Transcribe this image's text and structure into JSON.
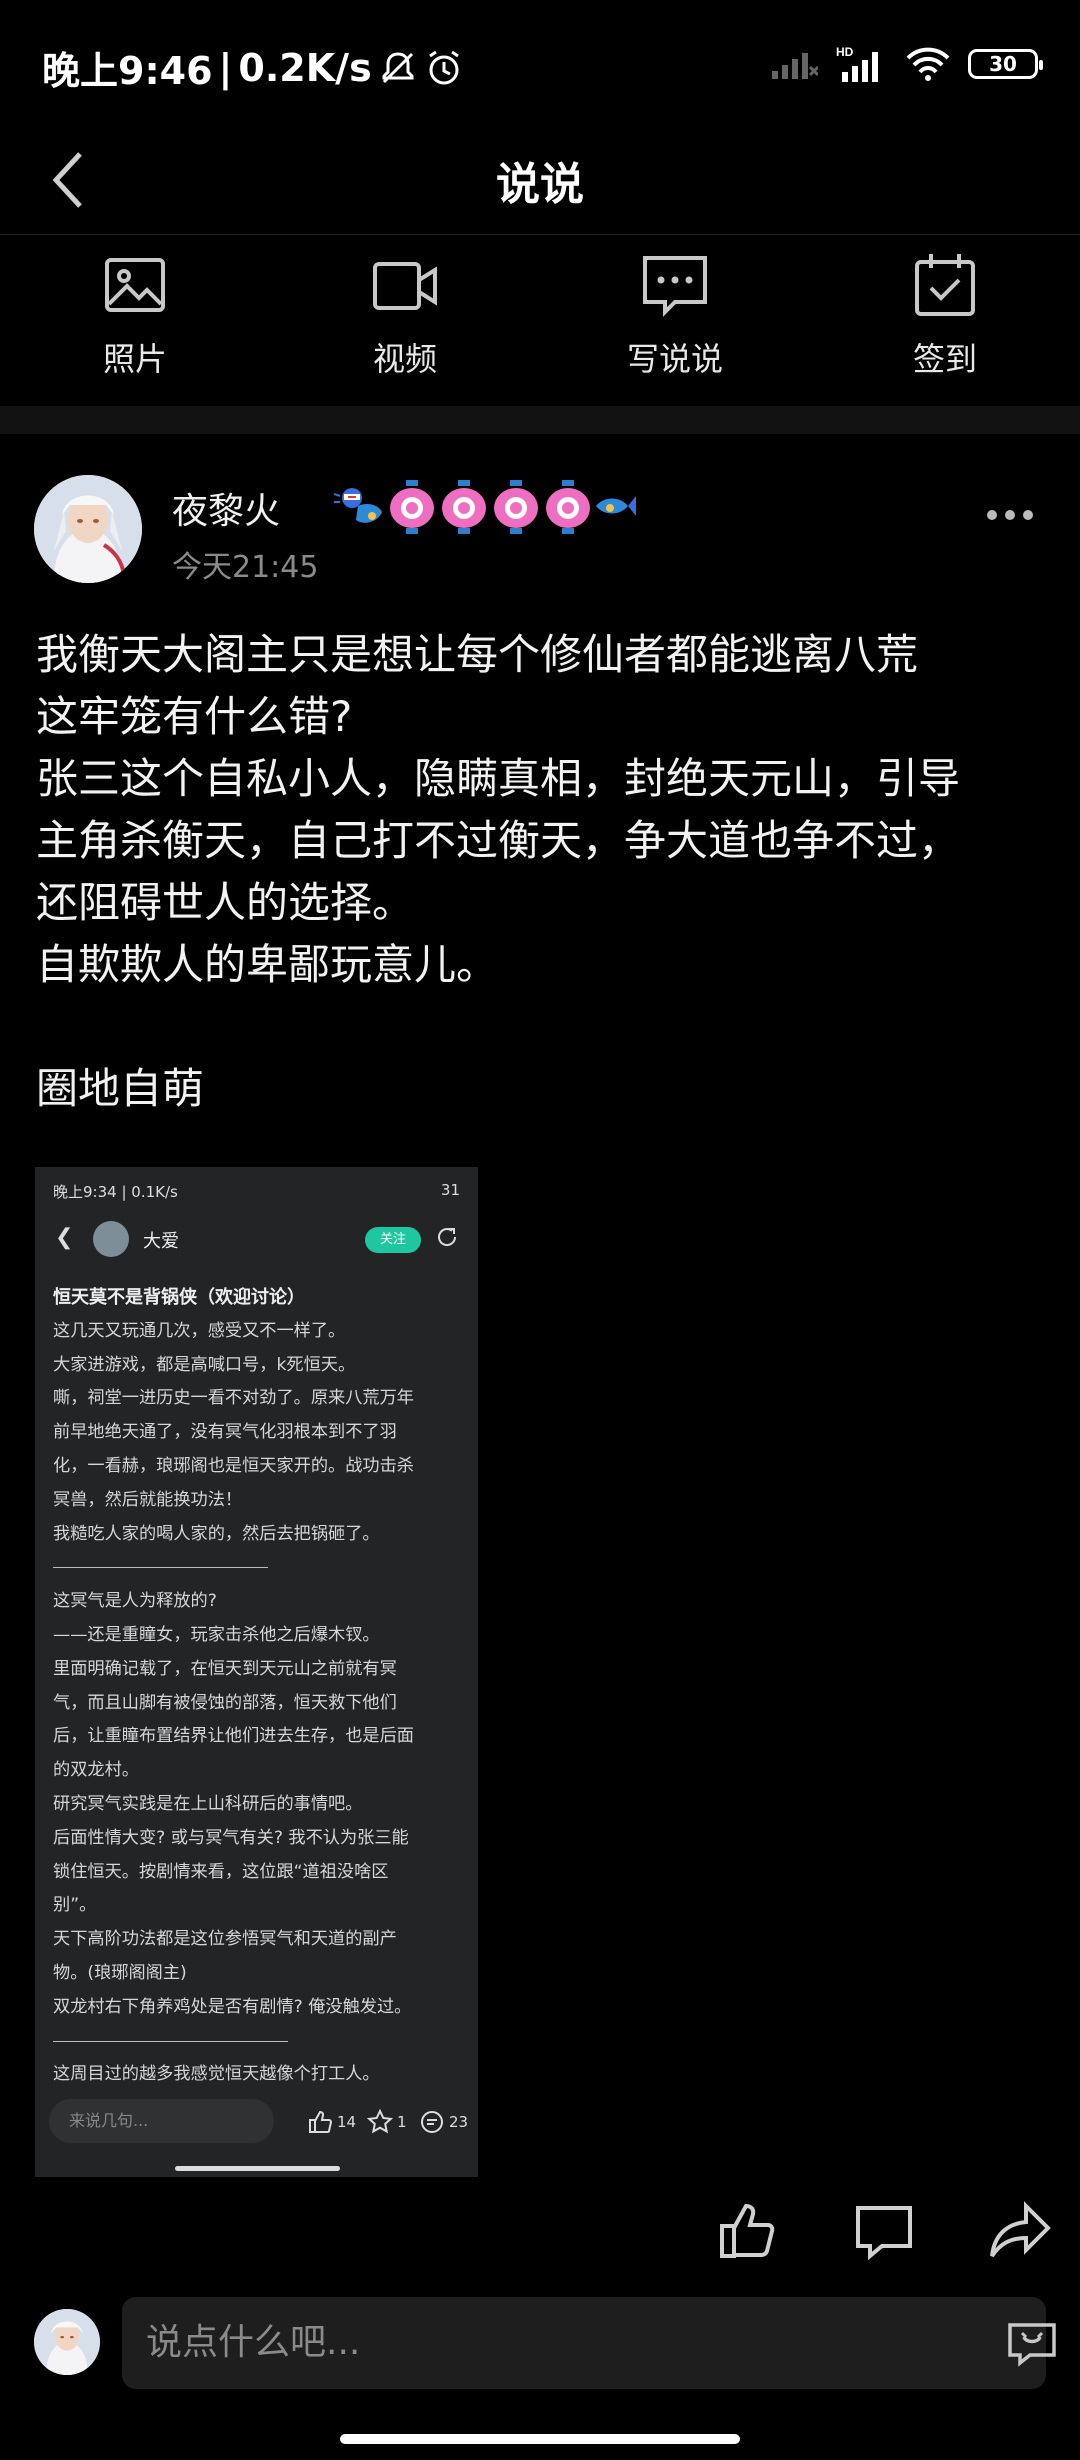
{
  "status_bar": {
    "time": "晚上9:46",
    "separator": "|",
    "speed": "0.2K/s",
    "battery": "30",
    "network": "HD"
  },
  "header": {
    "title": "说说"
  },
  "tabs": [
    {
      "label": "照片",
      "icon": "image-icon"
    },
    {
      "label": "视频",
      "icon": "video-icon"
    },
    {
      "label": "写说说",
      "icon": "chat-icon"
    },
    {
      "label": "签到",
      "icon": "calendar-check-icon"
    }
  ],
  "post": {
    "author": "夜黎火",
    "time": "今天21:45",
    "lines": [
      "我衡天大阁主只是想让每个修仙者都能逃离八荒",
      "这牢笼有什么错?",
      "张三这个自私小人，隐瞒真相，封绝天元山，引导",
      "主角杀衡天，自己打不过衡天，争大道也争不过，",
      "还阻碍世人的选择。",
      "自欺欺人的卑鄙玩意儿。"
    ],
    "tag_line": "圈地自萌"
  },
  "embed": {
    "status_time": "晚上9:34 | 0.1K/s",
    "status_battery": "31",
    "user": "大爱",
    "follow": "关注",
    "title": "恒天莫不是背锅侠（欢迎讨论）",
    "lines": [
      "这几天又玩通几次，感受又不一样了。",
      "大家进游戏，都是高喊口号，k死恒天。",
      "嘶，祠堂一进历史一看不对劲了。原来八荒万年",
      "前早地绝天通了，没有冥气化羽根本到不了羽",
      "化，一看赫，琅琊阁也是恒天家开的。战功击杀",
      "冥兽，然后就能换功法！",
      "我糙吃人家的喝人家的，然后去把锅砸了。"
    ],
    "lines2": [
      "这冥气是人为释放的?",
      "——还是重瞳女，玩家击杀他之后爆木钗。",
      "里面明确记载了，在恒天到天元山之前就有冥",
      "气，而且山脚有被侵蚀的部落，恒天救下他们",
      "后，让重瞳布置结界让他们进去生存，也是后面",
      "的双龙村。",
      "研究冥气实践是在上山科研后的事情吧。",
      "后面性情大变? 或与冥气有关? 我不认为张三能",
      "锁住恒天。按剧情来看，这位跟“道祖没啥区",
      "别”。",
      "天下高阶功法都是这位参悟冥气和天道的副产",
      "物。(琅琊阁阁主)",
      "双龙村右下角养鸡处是否有剧情? 俺没触发过。"
    ],
    "lines3": [
      "这周目过的越多我感觉恒天越像个打工人。"
    ],
    "input_placeholder": "来说几句...",
    "likes": "14",
    "stars": "1",
    "comments": "23"
  },
  "comment_bar": {
    "placeholder": "说点什么吧..."
  }
}
